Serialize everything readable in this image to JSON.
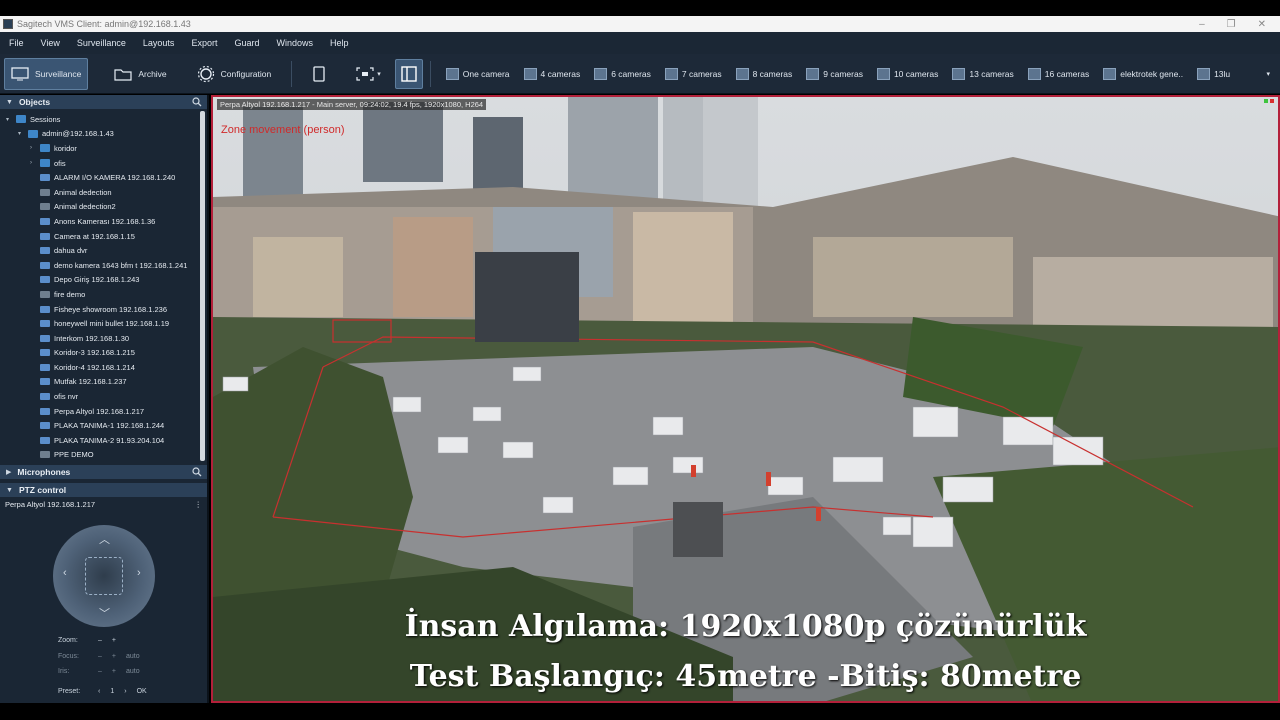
{
  "window": {
    "title": "Sagitech VMS Client: admin@192.168.1.43",
    "buttons": [
      "–",
      "❐",
      "✕"
    ]
  },
  "menu": [
    "File",
    "View",
    "Surveillance",
    "Layouts",
    "Export",
    "Guard",
    "Windows",
    "Help"
  ],
  "toolbar": {
    "surveillance": "Surveillance",
    "archive": "Archive",
    "configuration": "Configuration",
    "layouts": [
      "One camera",
      "4 cameras",
      "6 cameras",
      "7 cameras",
      "8 cameras",
      "9 cameras",
      "10 cameras",
      "13 cameras",
      "16 cameras",
      "elektrotek gene..",
      "13lu"
    ]
  },
  "sidebar": {
    "objects_title": "Objects",
    "tree": [
      {
        "label": "Sessions",
        "level": 0,
        "type": "folder",
        "arrow": "▾"
      },
      {
        "label": "admin@192.168.1.43",
        "level": 1,
        "type": "folder",
        "arrow": "▾"
      },
      {
        "label": "koridor",
        "level": 2,
        "type": "folder",
        "arrow": "›"
      },
      {
        "label": "ofis",
        "level": 2,
        "type": "folder",
        "arrow": "›"
      },
      {
        "label": "ALARM I/O KAMERA 192.168.1.240",
        "level": 2,
        "type": "cam"
      },
      {
        "label": "Animal dedection",
        "level": 2,
        "type": "dim"
      },
      {
        "label": "Animal dedection2",
        "level": 2,
        "type": "dim"
      },
      {
        "label": "Anons Kamerası 192.168.1.36",
        "level": 2,
        "type": "cam"
      },
      {
        "label": "Camera at 192.168.1.15",
        "level": 2,
        "type": "cam"
      },
      {
        "label": "dahua dvr",
        "level": 2,
        "type": "cam"
      },
      {
        "label": "demo kamera 1643 bfm t 192.168.1.241",
        "level": 2,
        "type": "cam"
      },
      {
        "label": "Depo Giriş 192.168.1.243",
        "level": 2,
        "type": "cam"
      },
      {
        "label": "fire demo",
        "level": 2,
        "type": "dim"
      },
      {
        "label": "Fisheye showroom 192.168.1.236",
        "level": 2,
        "type": "cam"
      },
      {
        "label": "honeywell mini bullet 192.168.1.19",
        "level": 2,
        "type": "cam"
      },
      {
        "label": "Interkom 192.168.1.30",
        "level": 2,
        "type": "cam"
      },
      {
        "label": "Koridor-3 192.168.1.215",
        "level": 2,
        "type": "cam"
      },
      {
        "label": "Koridor-4 192.168.1.214",
        "level": 2,
        "type": "cam"
      },
      {
        "label": "Mutfak 192.168.1.237",
        "level": 2,
        "type": "cam"
      },
      {
        "label": "ofis nvr",
        "level": 2,
        "type": "cam"
      },
      {
        "label": "Perpa Altyol 192.168.1.217",
        "level": 2,
        "type": "cam"
      },
      {
        "label": "PLAKA TANIMA-1 192.168.1.244",
        "level": 2,
        "type": "cam"
      },
      {
        "label": "PLAKA TANIMA-2 91.93.204.104",
        "level": 2,
        "type": "cam"
      },
      {
        "label": "PPE DEMO",
        "level": 2,
        "type": "dim"
      }
    ],
    "microphones_title": "Microphones",
    "ptz_title": "PTZ control",
    "ptz_camera": "Perpa Altyol 192.168.1.217",
    "zoom_label": "Zoom:",
    "focus_label": "Focus:",
    "iris_label": "Iris:",
    "preset_label": "Preset:",
    "auto": "auto",
    "preset_value": "1",
    "ok": "OK"
  },
  "view": {
    "camera_info": "Perpa Altyol 192.168.1.217 - Main server, 09:24:02, 19.4 fps, 1920x1080, H264",
    "zone_label": "Zone movement (person)",
    "caption_line1": "İnsan Algılama: 1920x1080p çözünürlük",
    "caption_line2": "Test Başlangıç: 45metre -Bitiş: 80metre"
  }
}
